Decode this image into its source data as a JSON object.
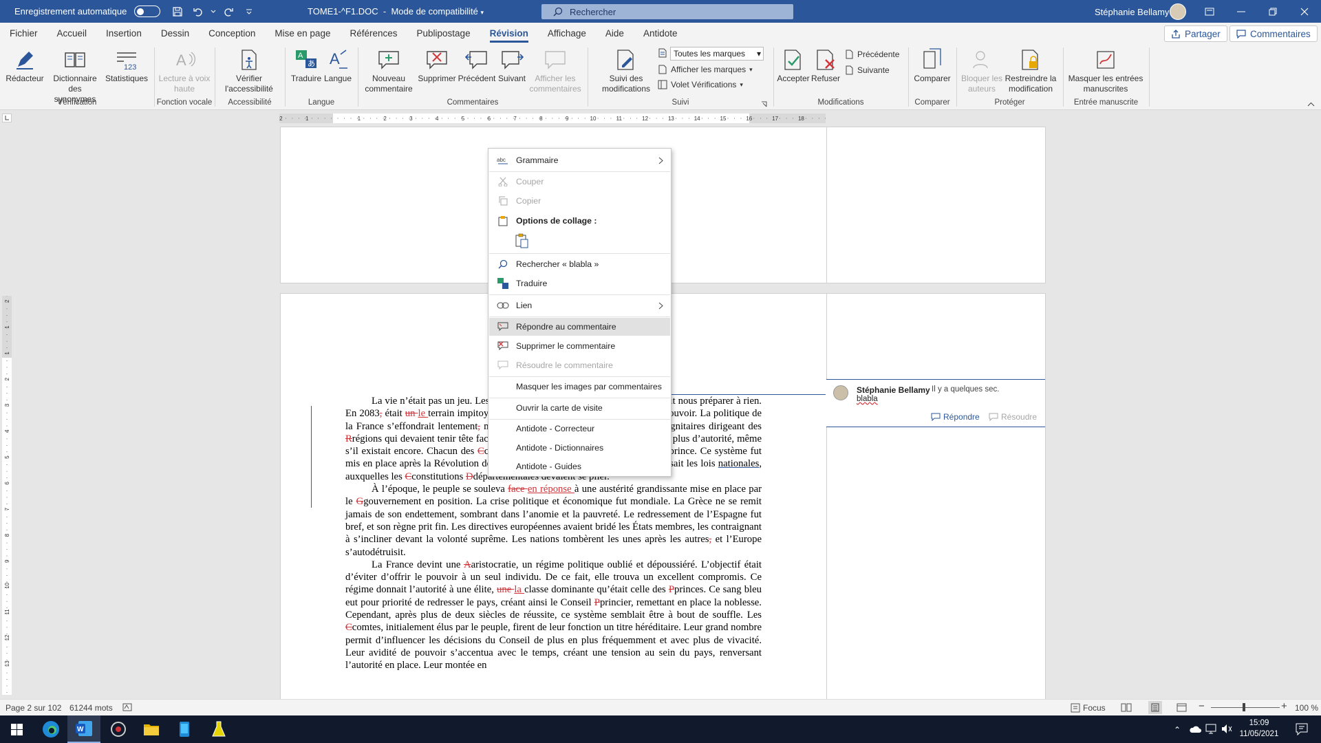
{
  "titlebar": {
    "autosave_label": "Enregistrement automatique",
    "doc_title": "TOME1-^F1.DOC",
    "mode": "Mode de compatibilité",
    "search_placeholder": "Rechercher",
    "user": "Stéphanie Bellamy"
  },
  "tabs": [
    "Fichier",
    "Accueil",
    "Insertion",
    "Dessin",
    "Conception",
    "Mise en page",
    "Références",
    "Publipostage",
    "Révision",
    "Affichage",
    "Aide",
    "Antidote"
  ],
  "active_tab": "Révision",
  "tab_buttons": {
    "share": "Partager",
    "comments": "Commentaires"
  },
  "ribbon": {
    "buttons": {
      "redacteur": "Rédacteur",
      "synonymes": "Dictionnaire des synonymes",
      "statistiques": "Statistiques",
      "lecture": "Lecture à voix haute",
      "accessibilite": "Vérifier l'accessibilité",
      "traduire": "Traduire",
      "langue": "Langue",
      "nouveau": "Nouveau commentaire",
      "supprimer": "Supprimer",
      "precedent": "Précédent",
      "suivant": "Suivant",
      "afficher": "Afficher les commentaires",
      "suivi": "Suivi des modifications",
      "markup_select": "Toutes les marques",
      "afficher_marques": "Afficher les marques",
      "volet": "Volet Vérifications",
      "accepter": "Accepter",
      "refuser": "Refuser",
      "precedente": "Précédente",
      "suivante": "Suivante",
      "comparer": "Comparer",
      "bloquer": "Bloquer les auteurs",
      "restreindre": "Restreindre la modification",
      "masquer": "Masquer les entrées manuscrites"
    },
    "groups": [
      "Vérification",
      "Fonction vocale",
      "Accessibilité",
      "Langue",
      "Commentaires",
      "Suivi",
      "Modifications",
      "Comparer",
      "Protéger",
      "Entrée manuscrite"
    ]
  },
  "ruler": {
    "h_numbers": [
      "2",
      "1",
      "1",
      "2",
      "3",
      "4",
      "5",
      "6",
      "7",
      "8",
      "9",
      "10",
      "11",
      "12",
      "13",
      "14",
      "15",
      "16",
      "17",
      "18"
    ],
    "v_numbers": [
      "2",
      "1",
      "1",
      "2",
      "3",
      "4",
      "5",
      "6",
      "7",
      "8",
      "9",
      "10",
      "11",
      "12",
      "13"
    ]
  },
  "document": {
    "p1_parts": [
      {
        "t": "La vie n’était pas un jeu. ",
        "c": "n"
      },
      {
        "t": "Les histoires que racontaient les livres ne pouvait nous préparer à rien. En 2083",
        "c": "n"
      },
      {
        "t": ",",
        "c": "del"
      },
      {
        "t": " était ",
        "c": "n"
      },
      {
        "t": "un ",
        "c": "del"
      },
      {
        "t": "le ",
        "c": "ins"
      },
      {
        "t": "terrain impitoyable de prédateurs",
        "c": "n"
      },
      {
        "t": ",",
        "c": "del"
      },
      {
        "t": " qui se battaient pour le pouvoir. La politique de la France s’effondrait lentement",
        "c": "n"
      },
      {
        "t": ",",
        "c": "del"
      },
      {
        "t": " mais sûrement, affaiblissant les plus hauts dignitaires dirigeant des ",
        "c": "n"
      },
      {
        "t": "R",
        "c": "del"
      },
      {
        "t": "régions qui devaient tenir tête face aux ",
        "c": "n"
      },
      {
        "t": "C",
        "c": "del"
      },
      {
        "t": "comtes",
        "c": "sq"
      },
      {
        "t": ". Désormais, le peuple n’avait plus d’autorité, même s’il existait encore. Chacun des ",
        "c": "n"
      },
      {
        "t": "C",
        "c": "del"
      },
      {
        "t": "comtes gérait un ",
        "c": "n"
      },
      {
        "t": "D",
        "c": "del"
      },
      {
        "t": "département au nom du ",
        "c": "n"
      },
      {
        "t": "P",
        "c": "del"
      },
      {
        "t": "prince. Ce système fut mis en place après la Révolution de",
        "c": "n"
      },
      {
        "t": " ",
        "c": "del"
      },
      {
        "t": " 2026, et une Constitution ",
        "c": "n"
      },
      {
        "t": "C",
        "c": "del"
      },
      {
        "t": "commune régissait les lois ",
        "c": "n"
      },
      {
        "t": "nationales",
        "c": "sq"
      },
      {
        "t": ", auxquelles les ",
        "c": "n"
      },
      {
        "t": "C",
        "c": "del"
      },
      {
        "t": "constitutions ",
        "c": "n"
      },
      {
        "t": "D",
        "c": "del"
      },
      {
        "t": "départementales devaient se plier.",
        "c": "n"
      }
    ],
    "p2_parts": [
      {
        "t": "À l’époque, le peuple se souleva ",
        "c": "n"
      },
      {
        "t": "face ",
        "c": "del"
      },
      {
        "t": "en réponse ",
        "c": "ins"
      },
      {
        "t": "à une austérité grandissante mise en place par le ",
        "c": "n"
      },
      {
        "t": "G",
        "c": "del"
      },
      {
        "t": "gouvernement en position. La crise politique et économique fut mondiale. La Grèce ne se remit jamais de son endettement, sombrant dans l’anomie et la pauvreté. Le redressement de l’Espagne fut bref, et son règne prit fin. Les directives européennes avaient bridé les États membres, les contraignant à s’incliner devant la volonté suprême. Les nations tombèrent les unes après les autres",
        "c": "n"
      },
      {
        "t": ",",
        "c": "del"
      },
      {
        "t": " et l’Europe s’autodétruisit.",
        "c": "n"
      }
    ],
    "p3_parts": [
      {
        "t": "La France devint une ",
        "c": "n"
      },
      {
        "t": "A",
        "c": "del"
      },
      {
        "t": "aristocratie, un régime politique oublié et dépoussiéré. L’objectif était d’éviter d’offrir le pouvoir à un seul individu. De ce fait, elle trouva un excellent compromis. Ce régime donnait l’autorité à une élite, ",
        "c": "n"
      },
      {
        "t": "une ",
        "c": "del"
      },
      {
        "t": "la ",
        "c": "ins"
      },
      {
        "t": "classe dominante qu’était celle des ",
        "c": "n"
      },
      {
        "t": "P",
        "c": "del"
      },
      {
        "t": "princes. Ce sang bleu eut pour priorité de redresser le pays, créant ainsi le Conseil ",
        "c": "n"
      },
      {
        "t": "P",
        "c": "del"
      },
      {
        "t": "princier, remettant en place la noblesse. Cependant, après plus de deux siècles de réussite, ce système semblait être à bout de souffle. Les ",
        "c": "n"
      },
      {
        "t": "C",
        "c": "del"
      },
      {
        "t": "comtes, initialement élus par le peuple, firent de leur fonction un titre héréditaire. Leur grand nombre permit d’influencer les décisions du Conseil de plus en plus fréquemment et avec plus de vivacité. Leur avidité de pouvoir s’accentua avec le temps, créant une tension au sein du pays, renversant l’autorité en place. Leur montée en",
        "c": "n"
      }
    ]
  },
  "comment": {
    "author": "Stéphanie Bellamy",
    "time": "Il y a quelques sec.",
    "body": "blabla",
    "reply": "Répondre",
    "resolve": "Résoudre"
  },
  "context_menu": {
    "grammaire": "Grammaire",
    "couper": "Couper",
    "copier": "Copier",
    "options_collage": "Options de collage :",
    "rechercher": "Rechercher « blabla »",
    "traduire": "Traduire",
    "lien": "Lien",
    "repondre": "Répondre au commentaire",
    "supprimer": "Supprimer le commentaire",
    "resoudre": "Résoudre le commentaire",
    "masquer_images": "Masquer les images par commentaires",
    "carte_visite": "Ouvrir la carte de visite",
    "antidote_correcteur": "Antidote - Correcteur",
    "antidote_dictionnaires": "Antidote - Dictionnaires",
    "antidote_guides": "Antidote - Guides"
  },
  "statusbar": {
    "page": "Page 2 sur 102",
    "words": "61244 mots",
    "focus": "Focus",
    "zoom": "100 %"
  },
  "taskbar": {
    "time": "15:09",
    "date": "11/05/2021"
  },
  "colors": {
    "accent": "#2b579a",
    "revision_red": "#d13438"
  }
}
